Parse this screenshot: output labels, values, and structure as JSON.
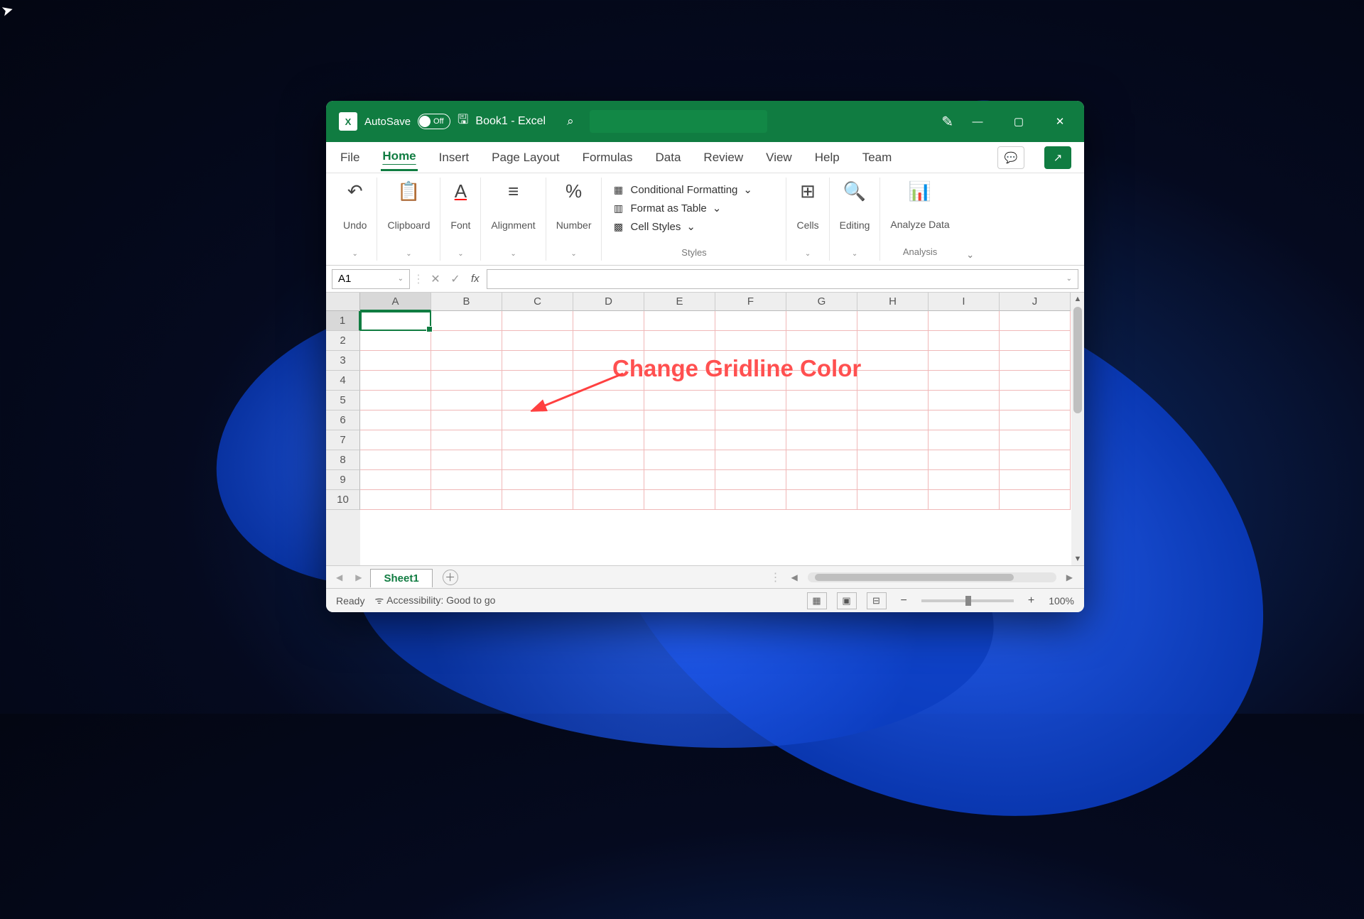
{
  "titlebar": {
    "autosave_label": "AutoSave",
    "autosave_state": "Off",
    "document_name": "Book1",
    "app_suffix": "  -  Excel"
  },
  "window_controls": {
    "minimize": "—",
    "maximize": "▢",
    "close": "✕"
  },
  "tabs": {
    "file": "File",
    "home": "Home",
    "insert": "Insert",
    "page_layout": "Page Layout",
    "formulas": "Formulas",
    "data": "Data",
    "review": "Review",
    "view": "View",
    "help": "Help",
    "team": "Team"
  },
  "ribbon": {
    "undo": "Undo",
    "clipboard": "Clipboard",
    "font": "Font",
    "alignment": "Alignment",
    "number": "Number",
    "styles": {
      "conditional": "Conditional Formatting",
      "table": "Format as Table",
      "cell": "Cell Styles",
      "group": "Styles"
    },
    "cells": "Cells",
    "editing": "Editing",
    "analyze": "Analyze Data",
    "analysis_group": "Analysis"
  },
  "formula_bar": {
    "name_box": "A1",
    "fx": "fx"
  },
  "grid": {
    "columns": [
      "A",
      "B",
      "C",
      "D",
      "E",
      "F",
      "G",
      "H",
      "I",
      "J"
    ],
    "rows": [
      "1",
      "2",
      "3",
      "4",
      "5",
      "6",
      "7",
      "8",
      "9",
      "10"
    ],
    "active_cell": "A1",
    "gridline_color": "#f0b8b8"
  },
  "annotation": {
    "text": "Change Gridline Color"
  },
  "sheet_tabs": {
    "active": "Sheet1"
  },
  "status": {
    "ready": "Ready",
    "accessibility": "Accessibility: Good to go",
    "zoom": "100%"
  }
}
